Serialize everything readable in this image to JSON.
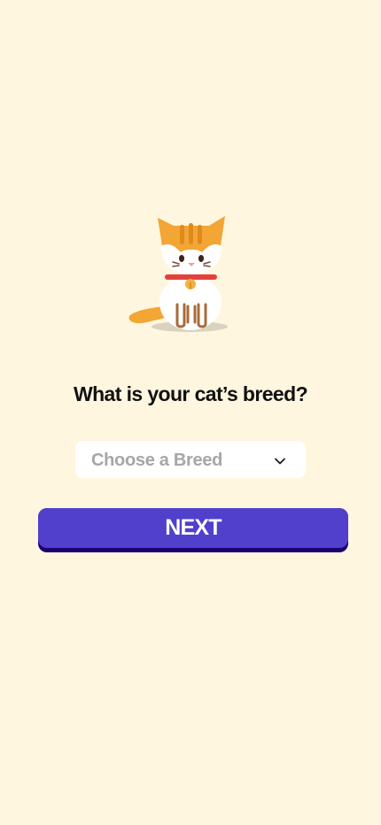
{
  "page": {
    "background_color": "#FFF6DF"
  },
  "illustration": {
    "icon": "cat-icon"
  },
  "question": {
    "text": "What is your cat’s breed?"
  },
  "breed_select": {
    "placeholder": "Choose a Breed",
    "value": "",
    "icon": "chevron-down-icon"
  },
  "next_button": {
    "label": "NEXT",
    "color": "#5040CC",
    "shadow_color": "#1C006E"
  }
}
